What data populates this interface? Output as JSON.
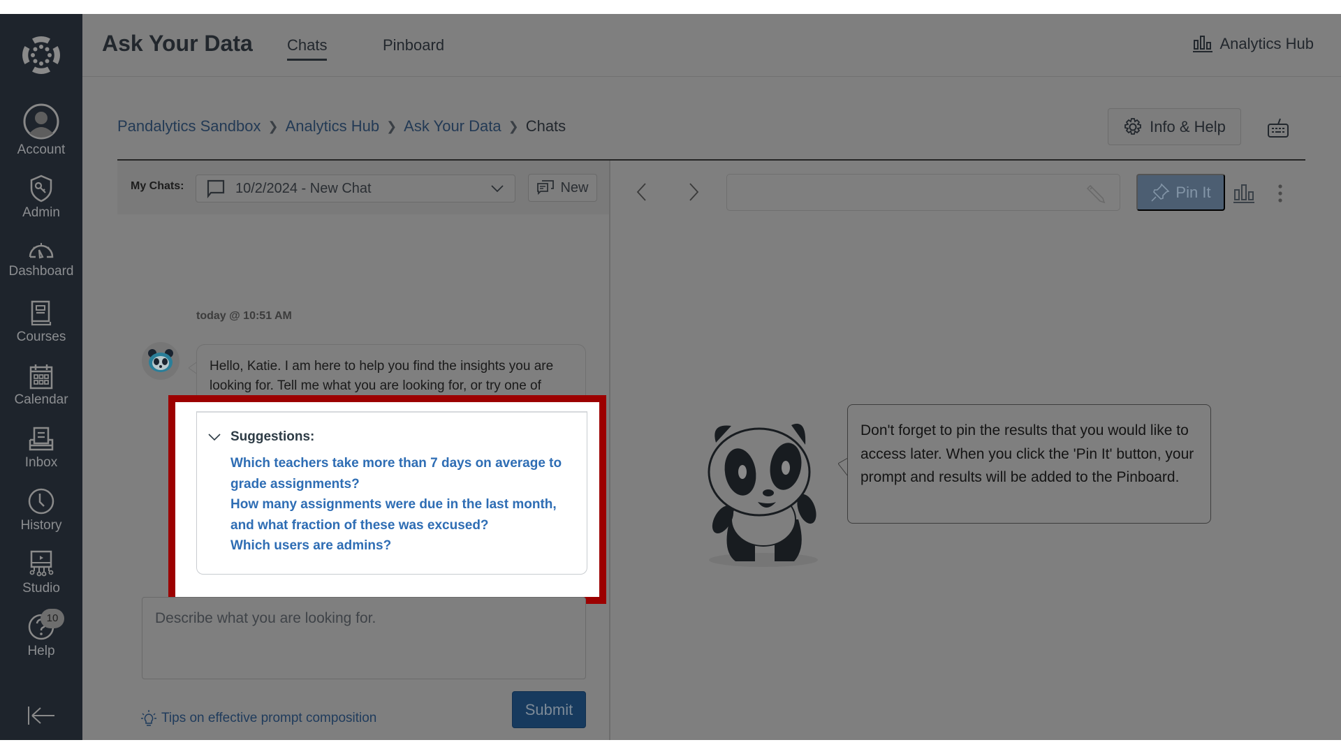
{
  "sidebar": {
    "items": [
      {
        "id": "account",
        "label": "Account",
        "icon": "account-avatar-icon"
      },
      {
        "id": "admin",
        "label": "Admin",
        "icon": "admin-shield-icon"
      },
      {
        "id": "dashboard",
        "label": "Dashboard",
        "icon": "dashboard-gauge-icon"
      },
      {
        "id": "courses",
        "label": "Courses",
        "icon": "courses-book-icon"
      },
      {
        "id": "calendar",
        "label": "Calendar",
        "icon": "calendar-icon"
      },
      {
        "id": "inbox",
        "label": "Inbox",
        "icon": "inbox-icon"
      },
      {
        "id": "history",
        "label": "History",
        "icon": "clock-icon"
      },
      {
        "id": "studio",
        "label": "Studio",
        "icon": "studio-icon"
      },
      {
        "id": "help",
        "label": "Help",
        "icon": "help-icon",
        "badge": "10"
      }
    ],
    "collapse_icon": "collapse-arrow-icon"
  },
  "header": {
    "title": "Ask Your Data",
    "tabs": [
      {
        "label": "Chats",
        "active": true
      },
      {
        "label": "Pinboard",
        "active": false
      }
    ],
    "hub_link": "Analytics Hub"
  },
  "breadcrumb": {
    "items": [
      "Pandalytics Sandbox",
      "Analytics Hub",
      "Ask Your Data"
    ],
    "current": "Chats"
  },
  "actions": {
    "info_help": "Info & Help"
  },
  "left_pane": {
    "my_chats_label": "My Chats:",
    "selected_chat": "10/2/2024 - New Chat",
    "new_button": "New",
    "message": {
      "timestamp": "today @ 10:51 AM",
      "text": "Hello, Katie. I am here to help you find the insights you are looking for. Tell me what you are looking for, or try one of these suggestions."
    },
    "suggestions": {
      "heading": "Suggestions:",
      "items": [
        "Which teachers take more than 7 days on average to grade assignments?",
        "How many assignments were due in the last month, and what fraction of these was excused?",
        "Which users are admins?"
      ]
    },
    "prompt_placeholder": "Describe what you are looking for.",
    "tips_link": "Tips on effective prompt composition",
    "submit": "Submit"
  },
  "right_pane": {
    "title_value": "",
    "pin_button": "Pin It",
    "tip_text": "Don't forget to pin the results that you would like to access later. When you click the 'Pin It' button, your prompt and results will be added to the Pinboard."
  },
  "colors": {
    "highlight_border": "#9c0000",
    "link": "#2e6db4",
    "sidebar_bg": "#1e242c",
    "overlay_bg": "#7f7f7f"
  }
}
